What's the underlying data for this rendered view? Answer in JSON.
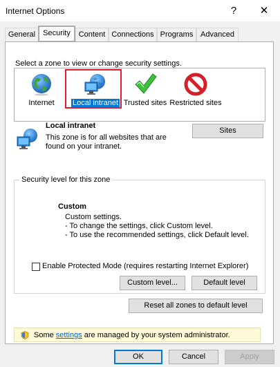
{
  "window": {
    "title": "Internet Options",
    "help_glyph": "?",
    "close_glyph": "✕"
  },
  "tabs": [
    {
      "label": "General"
    },
    {
      "label": "Security"
    },
    {
      "label": "Content"
    },
    {
      "label": "Connections"
    },
    {
      "label": "Programs"
    },
    {
      "label": "Advanced"
    }
  ],
  "active_tab": "Security",
  "security": {
    "zone_prompt": "Select a zone to view or change security settings.",
    "zones": [
      {
        "label": "Internet",
        "icon": "globe-icon"
      },
      {
        "label": "Local intranet",
        "icon": "local-intranet-icon"
      },
      {
        "label": "Trusted sites",
        "icon": "checkmark-icon"
      },
      {
        "label": "Restricted sites",
        "icon": "restricted-icon"
      }
    ],
    "selected_zone": "Local intranet",
    "zone_detail": {
      "name": "Local intranet",
      "description_line1": "This zone is for all websites that are",
      "description_line2": "found on your intranet."
    },
    "sites_button": "Sites",
    "level_group_title": "Security level for this zone",
    "level": {
      "name": "Custom",
      "line1": "Custom settings.",
      "line2": "- To change the settings, click Custom level.",
      "line3": "- To use the recommended settings, click Default level."
    },
    "protected_mode": {
      "label": "Enable Protected Mode (requires restarting Internet Explorer)",
      "checked": false
    },
    "custom_level_button": "Custom level...",
    "default_level_button": "Default level",
    "reset_all_button": "Reset all zones to default level"
  },
  "admin_notice": {
    "before": "Some ",
    "link": "settings",
    "after": " are managed by your system administrator."
  },
  "footer": {
    "ok": "OK",
    "cancel": "Cancel",
    "apply": "Apply"
  },
  "colors": {
    "highlight_red": "#e21b2c",
    "selection_blue": "#0078d7",
    "link_blue": "#0066cc",
    "notice_bg": "#fffbd9"
  }
}
